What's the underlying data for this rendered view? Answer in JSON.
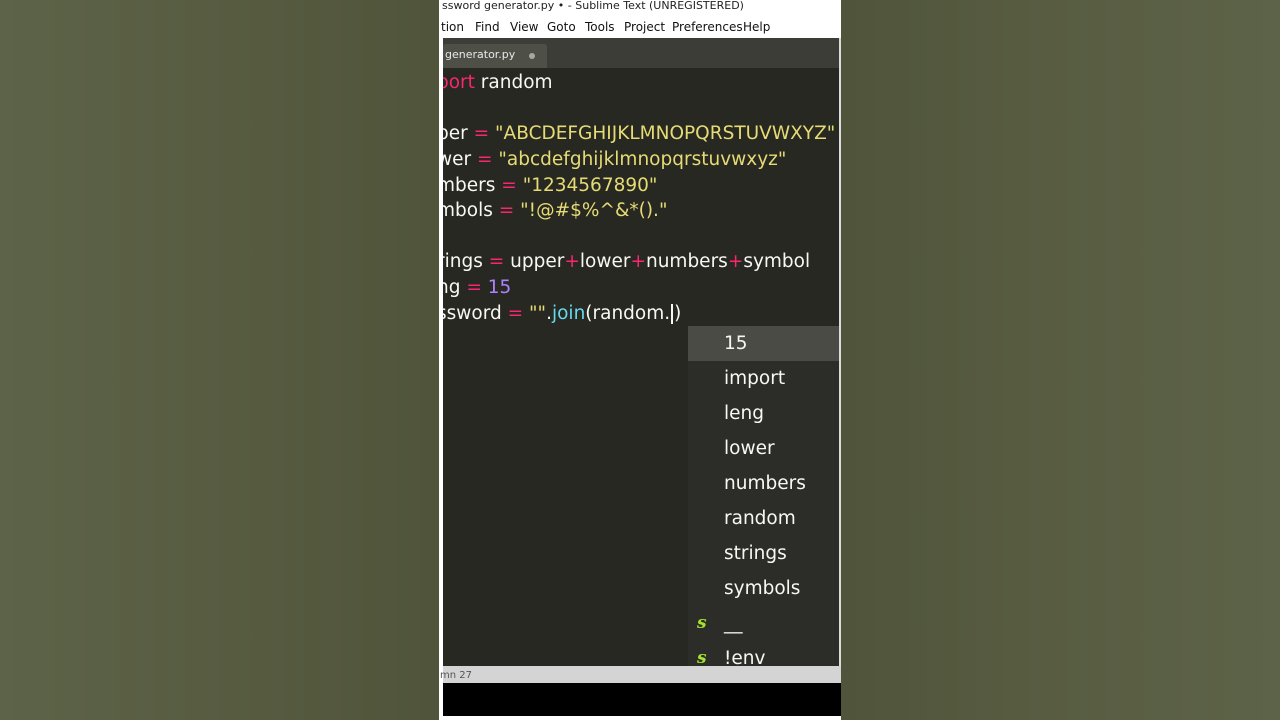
{
  "window": {
    "title": "ssword generator.py • - Sublime Text (UNREGISTERED)"
  },
  "menu": {
    "items": [
      "tion",
      "Find",
      "View",
      "Goto",
      "Tools",
      "Project",
      "Preferences",
      "Help"
    ]
  },
  "tab": {
    "name": "generator.py"
  },
  "code": {
    "line1": {
      "kw": "port",
      "rest": " random"
    },
    "line2": {
      "name": "per",
      "op": "=",
      "val": "\"ABCDEFGHIJKLMNOPQRSTUVWXYZ\""
    },
    "line3": {
      "name": "wer",
      "op": "=",
      "val": "\"abcdefghijklmnopqrstuvwxyz\""
    },
    "line4": {
      "name": "mbers",
      "op": "=",
      "val": "\"1234567890\""
    },
    "line5": {
      "name": "mbols",
      "op": "=",
      "val": "\"!@#$%^&*().\""
    },
    "line6": {
      "name": "rings",
      "op": "=",
      "p1": "upper",
      "plus": "+",
      "p2": "lower",
      "p3": "numbers",
      "p4": "symbol"
    },
    "line7": {
      "name": "ng",
      "op": "=",
      "val": "15"
    },
    "line8": {
      "name": "ssword",
      "op": "=",
      "str": "\"\"",
      "dot": ".",
      "fn": "join",
      "paren": "(",
      "arg": "random.",
      "close": ")"
    }
  },
  "autocomplete": {
    "items": [
      {
        "label": "15",
        "kind": ""
      },
      {
        "label": "import",
        "kind": ""
      },
      {
        "label": "leng",
        "kind": ""
      },
      {
        "label": "lower",
        "kind": ""
      },
      {
        "label": "numbers",
        "kind": ""
      },
      {
        "label": "random",
        "kind": ""
      },
      {
        "label": "strings",
        "kind": ""
      },
      {
        "label": "symbols",
        "kind": ""
      },
      {
        "label": "__",
        "kind": "s"
      },
      {
        "label": "!env",
        "kind": "s"
      }
    ],
    "selected_index": 0
  },
  "status": {
    "text": "mn 27"
  },
  "colors": {
    "editor_bg": "#272822",
    "keyword": "#f92672",
    "string": "#e6db74",
    "number": "#ae81ff",
    "function": "#66d9ef",
    "snippet_icon": "#a6e22e"
  }
}
